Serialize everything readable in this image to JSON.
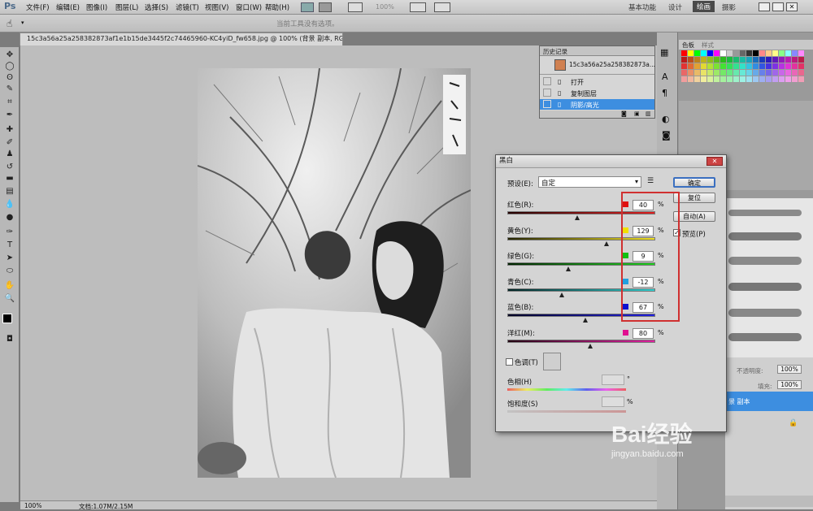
{
  "app": {
    "logo": "Ps"
  },
  "menu": [
    "文件(F)",
    "编辑(E)",
    "图像(I)",
    "图层(L)",
    "选择(S)",
    "滤镜(T)",
    "视图(V)",
    "窗口(W)",
    "帮助(H)"
  ],
  "menu_zoom": "100%",
  "workspaces": [
    "基本功能",
    "设计",
    "绘画",
    "摄影"
  ],
  "workspace_active_index": 2,
  "options_bar": {
    "hint": "当前工具没有选项。"
  },
  "document": {
    "tab_title": "15c3a56a25a258382873af1e1b15de3445f2c74465960-KC4yiD_fw658.jpg @ 100% (背景 副本, RGB/8) *",
    "close": "×"
  },
  "status": {
    "zoom": "100%",
    "doc_info": "文档:1.07M/2.15M"
  },
  "right_panels": {
    "swatch_tabs": [
      "色板",
      "样式"
    ],
    "opacity_label": "不透明度:",
    "opacity": "100%",
    "fill_label": "填充:",
    "fill": "100%",
    "layer_name": "景 副本"
  },
  "history": {
    "title": "历史记录",
    "snapshot": "15c3a56a25a258382873a...",
    "items": [
      "打开",
      "复制图层",
      "阴影/高光"
    ],
    "active_index": 2
  },
  "dialog": {
    "title": "黑白",
    "preset_label": "预设(E):",
    "preset_value": "自定",
    "buttons": {
      "ok": "确定",
      "reset": "复位",
      "auto": "自动(A)"
    },
    "preview_label": "预览(P)",
    "preview_checked": true,
    "sliders": [
      {
        "label": "红色(R):",
        "value": "40",
        "unit": "%",
        "swatch": "#e01010",
        "gradient": "linear-gradient(to right,#220000,#e02020)",
        "pos": 0.47
      },
      {
        "label": "黄色(Y):",
        "value": "129",
        "unit": "%",
        "swatch": "#f0e000",
        "gradient": "linear-gradient(to right,#222200,#f0e020)",
        "pos": 0.67
      },
      {
        "label": "绿色(G):",
        "value": "9",
        "unit": "%",
        "swatch": "#10c010",
        "gradient": "linear-gradient(to right,#002200,#20d020)",
        "pos": 0.41
      },
      {
        "label": "青色(C):",
        "value": "-12",
        "unit": "%",
        "swatch": "#20a0e0",
        "gradient": "linear-gradient(to right,#002222,#30d0d0)",
        "pos": 0.37
      },
      {
        "label": "蓝色(B):",
        "value": "67",
        "unit": "%",
        "swatch": "#1010d0",
        "gradient": "linear-gradient(to right,#000022,#2020e0)",
        "pos": 0.53
      },
      {
        "label": "洋红(M):",
        "value": "80",
        "unit": "%",
        "swatch": "#e01090",
        "gradient": "linear-gradient(to right,#220011,#e020a0)",
        "pos": 0.56
      }
    ],
    "tint_label": "色调(T)",
    "hue_label": "色相(H)",
    "hue_unit": "°",
    "saturation_label": "饱和度(S)",
    "saturation_unit": "%"
  },
  "watermark": {
    "text": "Bai经验",
    "url": "jingyan.baidu.com"
  }
}
